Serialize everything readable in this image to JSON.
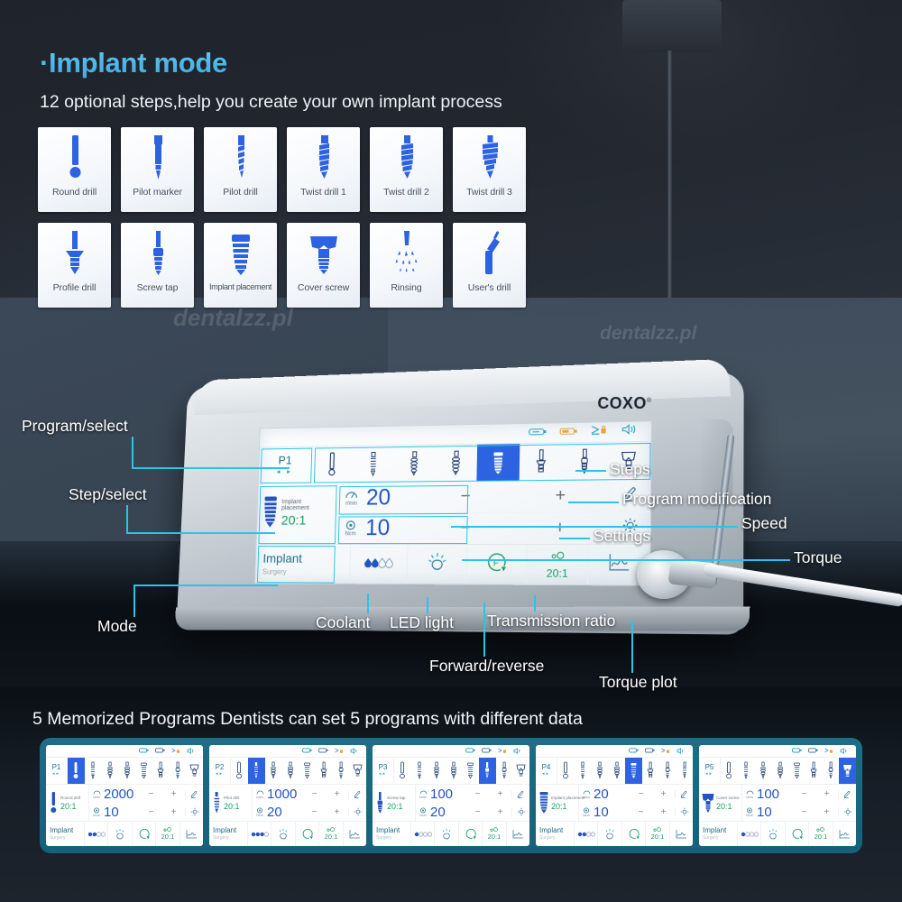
{
  "headline": "·Implant mode",
  "subhead": "12 optional steps,help you create your own implant process",
  "watermark": "dentalzz.pl",
  "watermark_big": "DENTALZZ",
  "brand": "COXO",
  "brand_sup": "®",
  "steps_grid": {
    "row1": [
      {
        "label": "Round drill",
        "icon": "round-drill-icon"
      },
      {
        "label": "Pilot marker",
        "icon": "pilot-marker-icon"
      },
      {
        "label": "Pilot drill",
        "icon": "pilot-drill-icon"
      },
      {
        "label": "Twist drill 1",
        "icon": "twist-drill-1-icon"
      },
      {
        "label": "Twist drill 2",
        "icon": "twist-drill-2-icon"
      },
      {
        "label": "Twist drill 3",
        "icon": "twist-drill-3-icon"
      }
    ],
    "row2": [
      {
        "label": "Profile drill",
        "icon": "profile-drill-icon"
      },
      {
        "label": "Screw tap",
        "icon": "screw-tap-icon"
      },
      {
        "label": "Implant placement",
        "icon": "implant-placement-icon"
      },
      {
        "label": "Cover screw",
        "icon": "cover-screw-icon"
      },
      {
        "label": "Rinsing",
        "icon": "rinsing-icon"
      },
      {
        "label": "User's drill",
        "icon": "users-drill-icon"
      }
    ]
  },
  "device_screen": {
    "status_icons": [
      "pedal-icon",
      "battery-icon",
      "lock-icon",
      "volume-icon"
    ],
    "program": {
      "id": "P1",
      "arrows": "◂ ▸"
    },
    "step_icons": [
      "round-drill-icon",
      "pilot-drill-icon",
      "twist-drill-icon",
      "twist-drill-icon",
      "implant-placement-icon",
      "profile-drill-icon",
      "screw-tap-icon",
      "cover-screw-icon"
    ],
    "active_step_index": 4,
    "current_step_name": "Implant placement",
    "current_step_name_line1": "Implant",
    "current_step_name_line2": "placement",
    "ratio": "20:1",
    "speed": {
      "value": "20",
      "unit": "r/min"
    },
    "torque": {
      "value": "10",
      "unit": "Ncm"
    },
    "minus": "−",
    "plus": "+",
    "edit_icon": "pencil-icon",
    "settings_icon": "gear-icon",
    "mode": {
      "main": "Implant",
      "sub": "Surgery"
    },
    "coolant_level": "2",
    "bottom_ratio": "20:1",
    "forward_label": "F",
    "bottom_icons": [
      "coolant-icon",
      "led-light-icon",
      "forward-reverse-icon",
      "transmission-ratio-icon",
      "torque-plot-icon"
    ]
  },
  "callouts": {
    "program_select": "Program/select",
    "step_select": "Step/select",
    "mode": "Mode",
    "steps": "Steps",
    "program_modification": "Program modification",
    "speed": "Speed",
    "settings": "Settings",
    "torque": "Torque",
    "coolant": "Coolant",
    "led_light": "LED light",
    "transmission_ratio": "Transmission ratio",
    "forward_reverse": "Forward/reverse",
    "torque_plot": "Torque plot"
  },
  "bottom": {
    "title": "5 Memorized Programs Dentists can set 5 programs with different data",
    "programs": [
      {
        "id": "P1",
        "step_name": "Round drill",
        "step_icon": "round-drill-icon",
        "active_index": 0,
        "ratio": "20:1",
        "speed": "2000",
        "torque": "10",
        "mode_main": "Implant",
        "mode_sub": "Surgery",
        "bottom_ratio": "20:1"
      },
      {
        "id": "P2",
        "step_name": "Pilot drill",
        "step_icon": "pilot-drill-icon",
        "active_index": 1,
        "ratio": "20:1",
        "speed": "1000",
        "torque": "20",
        "mode_main": "Implant",
        "mode_sub": "Surgery",
        "bottom_ratio": "20:1"
      },
      {
        "id": "P3",
        "step_name": "Screw tap",
        "step_icon": "screw-tap-icon",
        "active_index": 5,
        "ratio": "20:1",
        "speed": "100",
        "torque": "20",
        "mode_main": "Implant",
        "mode_sub": "Surgery",
        "bottom_ratio": "20:1"
      },
      {
        "id": "P4",
        "step_name": "Implant placement",
        "step_icon": "implant-placement-icon",
        "active_index": 4,
        "ratio": "20:1",
        "speed": "20",
        "torque": "10",
        "mode_main": "Implant",
        "mode_sub": "Surgery",
        "bottom_ratio": "20:1"
      },
      {
        "id": "P5",
        "step_name": "Cover screw",
        "step_icon": "cover-screw-icon",
        "active_index": 7,
        "ratio": "20:1",
        "speed": "100",
        "torque": "10",
        "mode_main": "Implant",
        "mode_sub": "Surgery",
        "bottom_ratio": "20:1"
      }
    ],
    "minus": "−",
    "plus": "+",
    "arrows": "◂▸"
  },
  "colors": {
    "accent_cyan": "#2ec2ea",
    "headline_blue": "#4fb3e8",
    "drill_blue": "#2d62e0",
    "value_blue": "#2254c4",
    "green": "#17a05e",
    "panel_teal": "#1d6e86"
  }
}
